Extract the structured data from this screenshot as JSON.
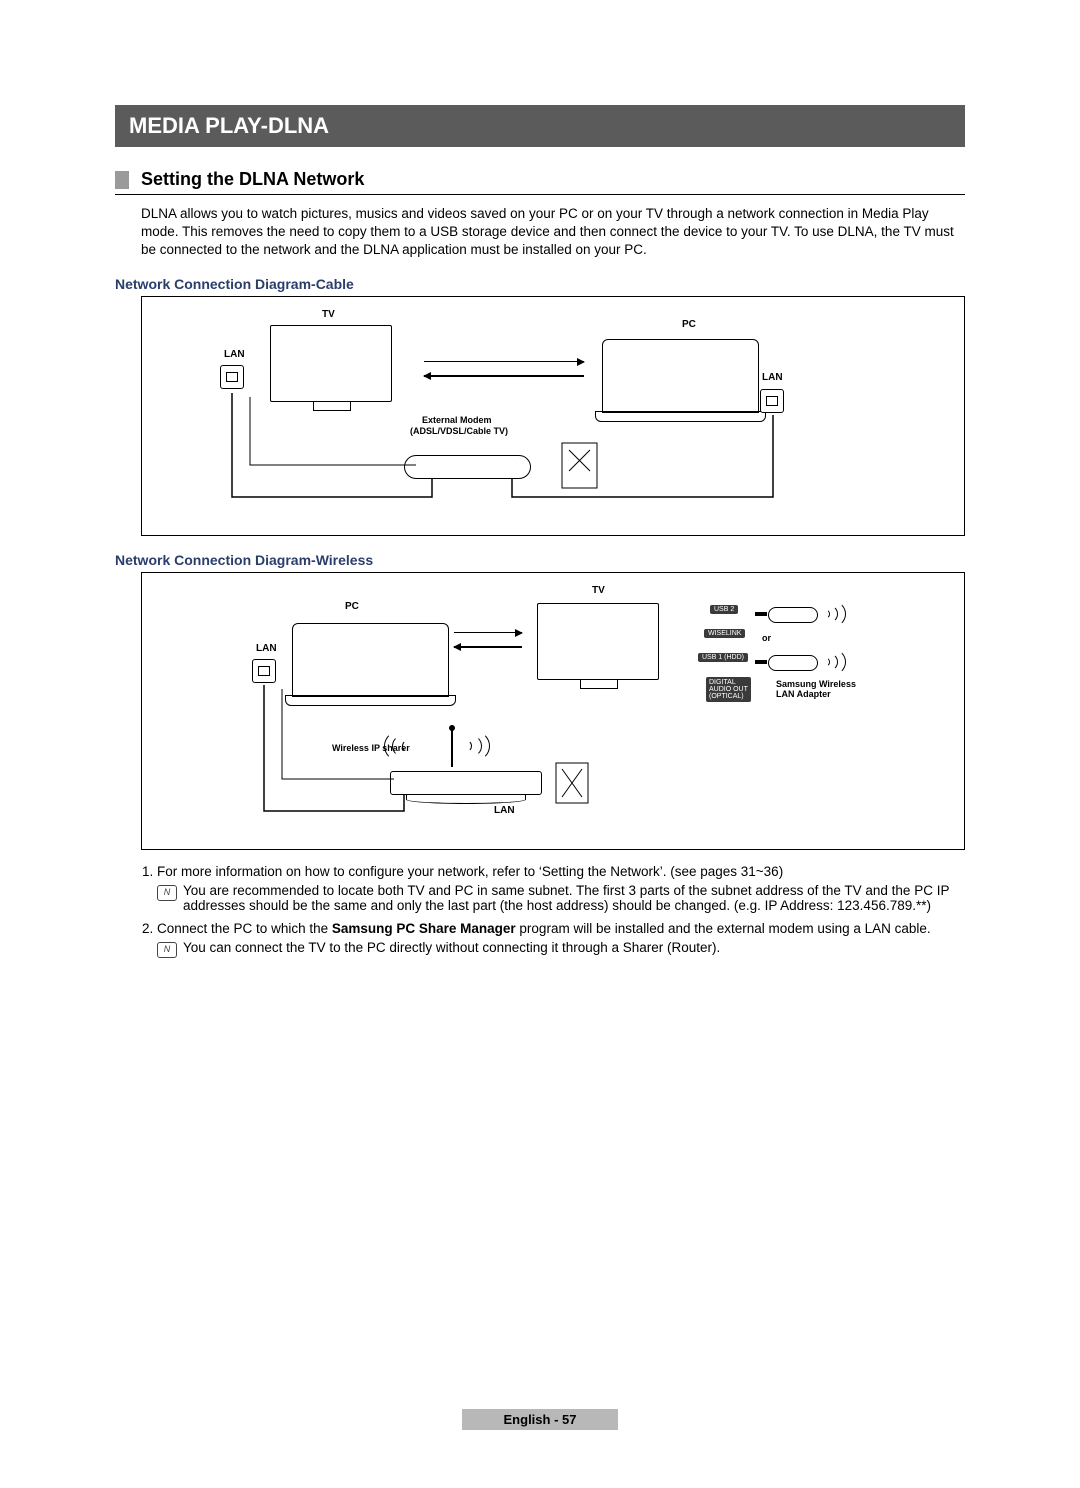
{
  "title": "MEDIA PLAY-DLNA",
  "sub": "Setting the DLNA Network",
  "intro": "DLNA allows you to watch pictures, musics and videos saved on your PC or on your TV through a network connection in Media Play mode. This removes the need to copy them to a USB storage device and then connect the device to your TV. To use DLNA, the TV must be connected to the network and the DLNA application must be installed on your PC.",
  "h_cable": "Network Connection Diagram-Cable",
  "h_wireless": "Network Connection Diagram-Wireless",
  "diag1": {
    "tv": "TV",
    "pc": "PC",
    "lan1": "LAN",
    "lan2": "LAN",
    "modem_l1": "External Modem",
    "modem_l2": "(ADSL/VDSL/Cable TV)"
  },
  "diag2": {
    "pc": "PC",
    "tv": "TV",
    "lan1": "LAN",
    "lan2": "LAN",
    "sharer": "Wireless IP sharer",
    "or": "or",
    "adapter_l1": "Samsung Wireless",
    "adapter_l2": "LAN Adapter",
    "port_usb": "USB 2",
    "port_wis": "WISELINK",
    "port_u1": "USB 1 (HDD)",
    "port_opt_l1": "DIGITAL",
    "port_opt_l2": "AUDIO OUT",
    "port_opt_l3": "(OPTICAL)"
  },
  "list": {
    "i1": "For more information on how to configure your network, refer to ‘Setting the Network’. (see pages 31~36)",
    "n1": "You are recommended to locate both TV and PC in same subnet. The first 3 parts of the subnet address of the TV and the PC IP addresses should be the same and only the last part (the host address) should be changed. (e.g. IP Address: 123.456.789.**)",
    "i2_pre": "Connect the PC to which the ",
    "i2_bold": "Samsung PC Share Manager",
    "i2_post": " program will be installed and the external modem using a LAN cable.",
    "n2": "You can connect the TV to the PC directly without connecting it through a Sharer (Router)."
  },
  "footer": "English - 57"
}
